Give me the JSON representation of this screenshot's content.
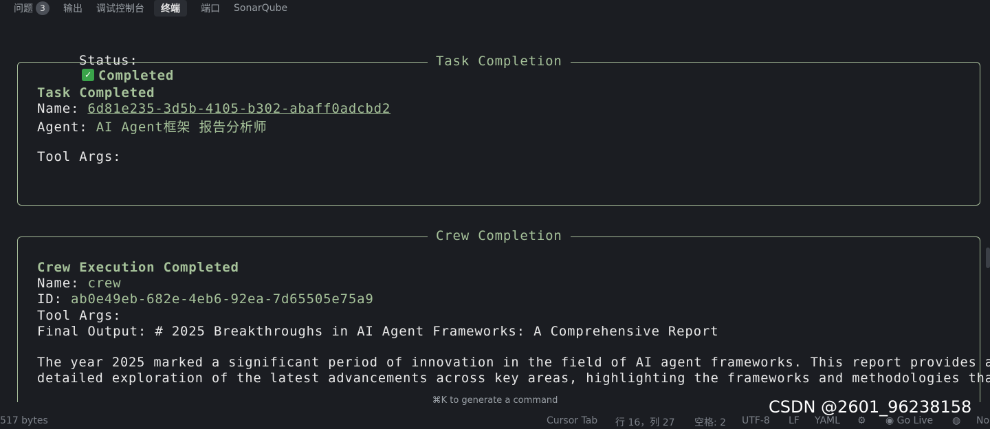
{
  "tabs": {
    "problems": "问题",
    "problems_count": "3",
    "output": "输出",
    "debug_console": "调试控制台",
    "terminal": "终端",
    "ports": "端口",
    "sonarqube": "SonarQube"
  },
  "terminal": {
    "status_label": "Status:",
    "status_icon": "✓",
    "status_value": "Completed",
    "task_panel": {
      "title": "Task Completion",
      "heading": "Task Completed",
      "name_label": "Name:",
      "name_value": "6d81e235-3d5b-4105-b302-abaff0adcbd2",
      "agent_label": "Agent:",
      "agent_value": "AI Agent框架 报告分析师",
      "tool_args_label": "Tool Args:"
    },
    "crew_panel": {
      "title": "Crew Completion",
      "heading": "Crew Execution Completed",
      "name_label": "Name:",
      "name_value": "crew",
      "id_label": "ID:",
      "id_value": "ab0e49eb-682e-4eb6-92ea-7d65505e75a9",
      "tool_args_label": "Tool Args:",
      "final_output_line": "Final Output: # 2025 Breakthroughs in AI Agent Frameworks: A Comprehensive Report",
      "body_line1": "The year 2025 marked a significant period of innovation in the field of AI agent frameworks. This report provides a",
      "body_line2": "detailed exploration of the latest advancements across key areas, highlighting the frameworks and methodologies that"
    }
  },
  "hint": "⌘K to generate a command",
  "statusbar": {
    "bytes": "517 bytes",
    "cursor_tab": "Cursor Tab",
    "position": "行 16，列 27",
    "spaces": "空格: 2",
    "encoding": "UTF-8",
    "eol": "LF",
    "language": "YAML",
    "go_live": "Go Live",
    "trailing": "No"
  },
  "watermark": "CSDN @2601_96238158"
}
